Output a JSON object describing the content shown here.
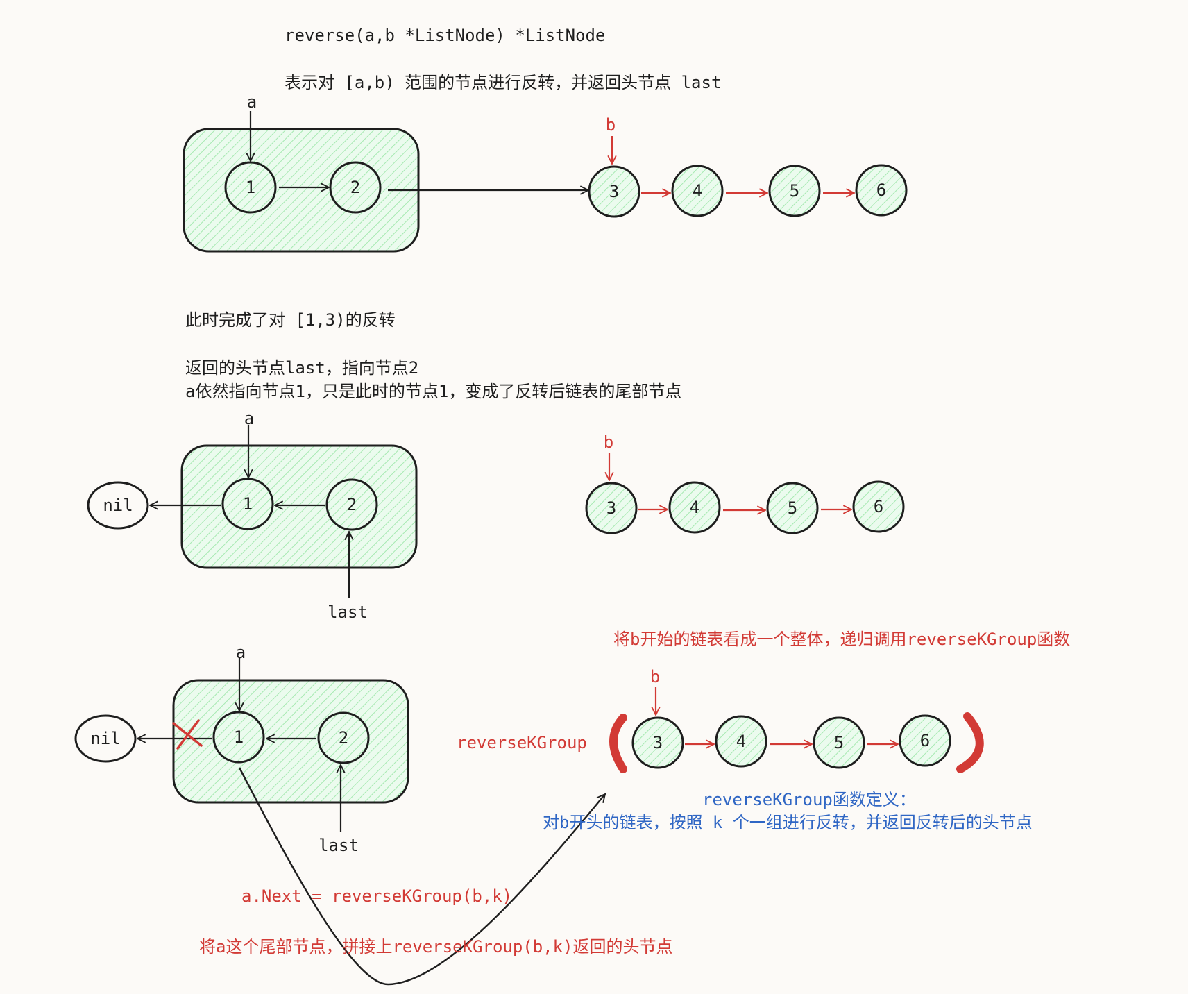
{
  "header": {
    "signature": "reverse(a,b *ListNode) *ListNode",
    "description": "表示对 [a,b) 范围的节点进行反转，并返回头节点 last"
  },
  "step2": {
    "line1": "此时完成了对 [1,3)的反转",
    "line2": "返回的头节点last，指向节点2",
    "line3": "a依然指向节点1，只是此时的节点1，变成了反转后链表的尾部节点"
  },
  "step3": {
    "recursive_note": "将b开始的链表看成一个整体，递归调用reverseKGroup函数",
    "call_label": "reverseKGroup",
    "definition_title": "reverseKGroup函数定义：",
    "definition_body": "对b开头的链表，按照 k 个一组进行反转，并返回反转后的头节点",
    "assign_code": "a.Next = reverseKGroup(b,k)",
    "splice_note": "将a这个尾部节点，拼接上reverseKGroup(b,k)返回的头节点"
  },
  "pointers": {
    "a": "a",
    "b": "b",
    "last": "last",
    "nil": "nil"
  },
  "diagrams": [
    {
      "id": "d1",
      "group_nodes": [
        "1",
        "2"
      ],
      "chain_nodes": [
        "3",
        "4",
        "5",
        "6"
      ]
    },
    {
      "id": "d2",
      "group_nodes": [
        "1",
        "2"
      ],
      "chain_nodes": [
        "3",
        "4",
        "5",
        "6"
      ]
    },
    {
      "id": "d3",
      "group_nodes": [
        "1",
        "2"
      ],
      "chain_nodes": [
        "3",
        "4",
        "5",
        "6"
      ]
    }
  ],
  "colors": {
    "ink": "#1e1e1e",
    "red": "#d23a35",
    "blue": "#2f66c4",
    "hatch": "#b2f2bb",
    "fill": "#ebfbee",
    "background": "#fcfaf7"
  }
}
